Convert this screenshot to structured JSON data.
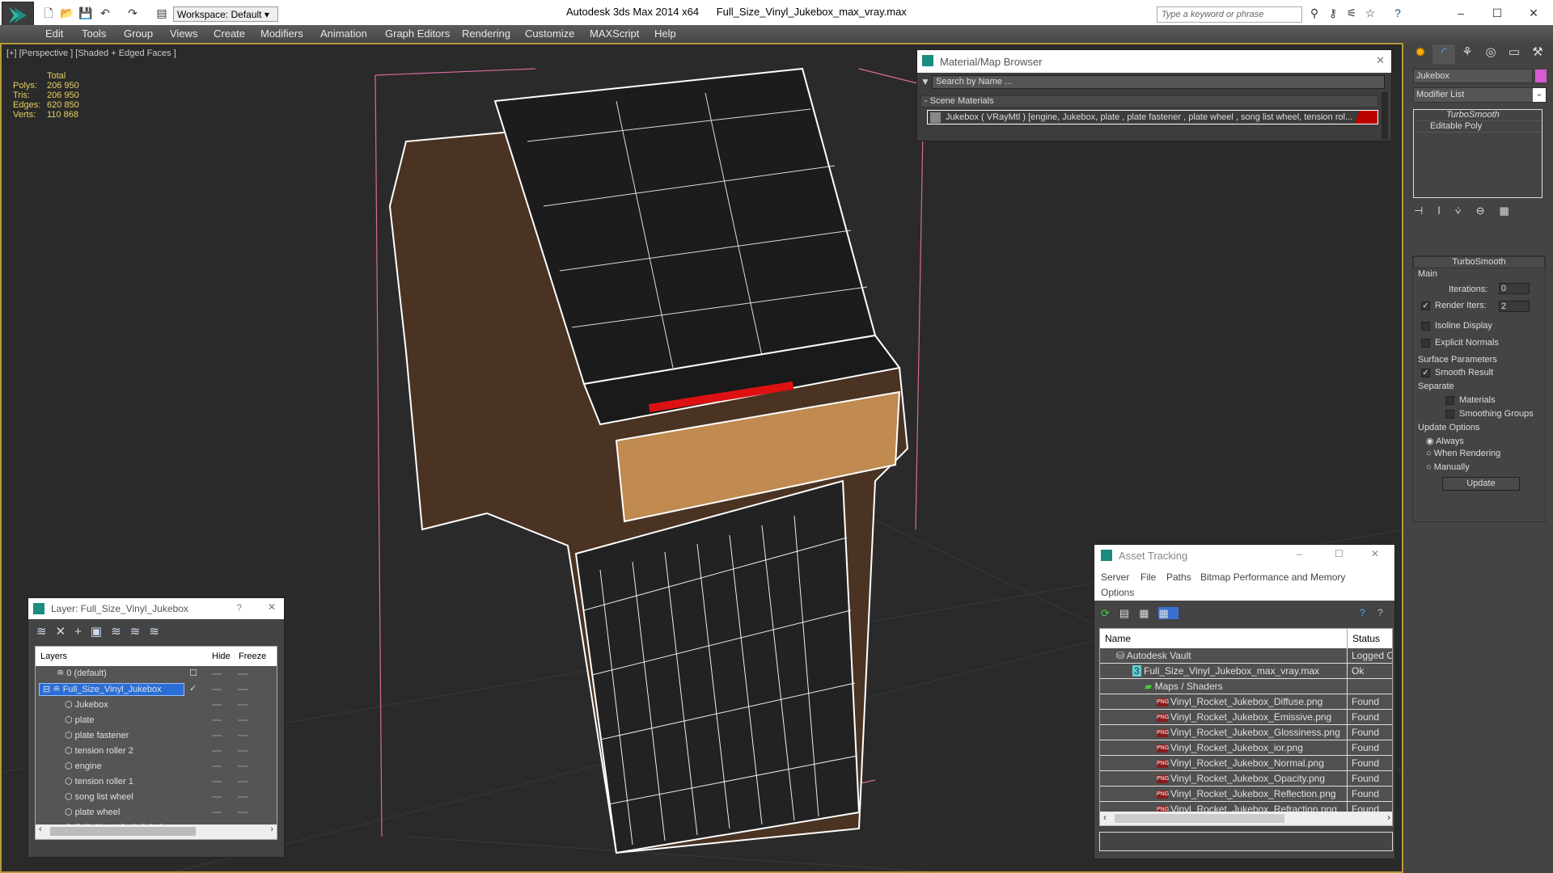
{
  "titlebar": {
    "app": "Autodesk 3ds Max  2014 x64",
    "file": "Full_Size_Vinyl_Jukebox_max_vray.max",
    "workspace": "Workspace: Default",
    "search_placeholder": "Type a keyword or phrase"
  },
  "menu": [
    "Edit",
    "Tools",
    "Group",
    "Views",
    "Create",
    "Modifiers",
    "Animation",
    "Graph Editors",
    "Rendering",
    "Customize",
    "MAXScript",
    "Help"
  ],
  "viewport": {
    "label": "[+] [Perspective ] [Shaded + Edged Faces ]",
    "stats": {
      "header": "Total",
      "rows": [
        {
          "k": "Polys:",
          "v": "206 950"
        },
        {
          "k": "Tris:",
          "v": "206 950"
        },
        {
          "k": "Edges:",
          "v": "620 850"
        },
        {
          "k": "Verts:",
          "v": "110 868"
        }
      ]
    }
  },
  "material_browser": {
    "title": "Material/Map Browser",
    "search": "Search by Name ...",
    "section": "- Scene Materials",
    "item": "Jukebox  ( VRayMtl ) [engine, Jukebox, plate , plate fastener , plate wheel , song list wheel, tension rol..."
  },
  "command_panel": {
    "object_name": "Jukebox",
    "object_color": "#d65ad0",
    "modifier_list": "Modifier List",
    "stack": [
      "TurboSmooth",
      "Editable Poly"
    ],
    "rollout": "TurboSmooth",
    "main": "Main",
    "iterations_label": "Iterations:",
    "iterations": "0",
    "render_iters_label": "Render Iters:",
    "render_iters": "2",
    "isoline": "Isoline Display",
    "explicit": "Explicit Normals",
    "surface": "Surface Parameters",
    "smooth_result": "Smooth Result",
    "separate": "Separate",
    "materials": "Materials",
    "smoothing_groups": "Smoothing Groups",
    "update_options": "Update Options",
    "always": "Always",
    "when_rendering": "When Rendering",
    "manually": "Manually",
    "update": "Update"
  },
  "layer_panel": {
    "title": "Layer: Full_Size_Vinyl_Jukebox",
    "help": "?",
    "col_layers": "Layers",
    "col_hide": "Hide",
    "col_freeze": "Freeze",
    "layers": [
      "0 (default)",
      "Full_Size_Vinyl_Jukebox"
    ],
    "objects": [
      "Jukebox",
      "plate",
      "plate fastener",
      "tension roller 2",
      "engine",
      "tension roller 1",
      "song list wheel",
      "plate wheel",
      "Full_Size_Vinyl_Jukebox"
    ]
  },
  "asset_tracking": {
    "title": "Asset Tracking",
    "menu": [
      "Server",
      "File",
      "Paths",
      "Bitmap Performance and Memory",
      "Options"
    ],
    "col_name": "Name",
    "col_status": "Status",
    "rows": [
      {
        "name": "Autodesk Vault",
        "status": "Logged O"
      },
      {
        "name": "Full_Size_Vinyl_Jukebox_max_vray.max",
        "status": "Ok"
      },
      {
        "name": "Maps / Shaders",
        "status": ""
      },
      {
        "name": "Vinyl_Rocket_Jukebox_Diffuse.png",
        "status": "Found"
      },
      {
        "name": "Vinyl_Rocket_Jukebox_Emissive.png",
        "status": "Found"
      },
      {
        "name": "Vinyl_Rocket_Jukebox_Glossiness.png",
        "status": "Found"
      },
      {
        "name": "Vinyl_Rocket_Jukebox_ior.png",
        "status": "Found"
      },
      {
        "name": "Vinyl_Rocket_Jukebox_Normal.png",
        "status": "Found"
      },
      {
        "name": "Vinyl_Rocket_Jukebox_Opacity.png",
        "status": "Found"
      },
      {
        "name": "Vinyl_Rocket_Jukebox_Reflection.png",
        "status": "Found"
      },
      {
        "name": "Vinyl_Rocket_Jukebox_Refraction.png",
        "status": "Found"
      }
    ]
  }
}
